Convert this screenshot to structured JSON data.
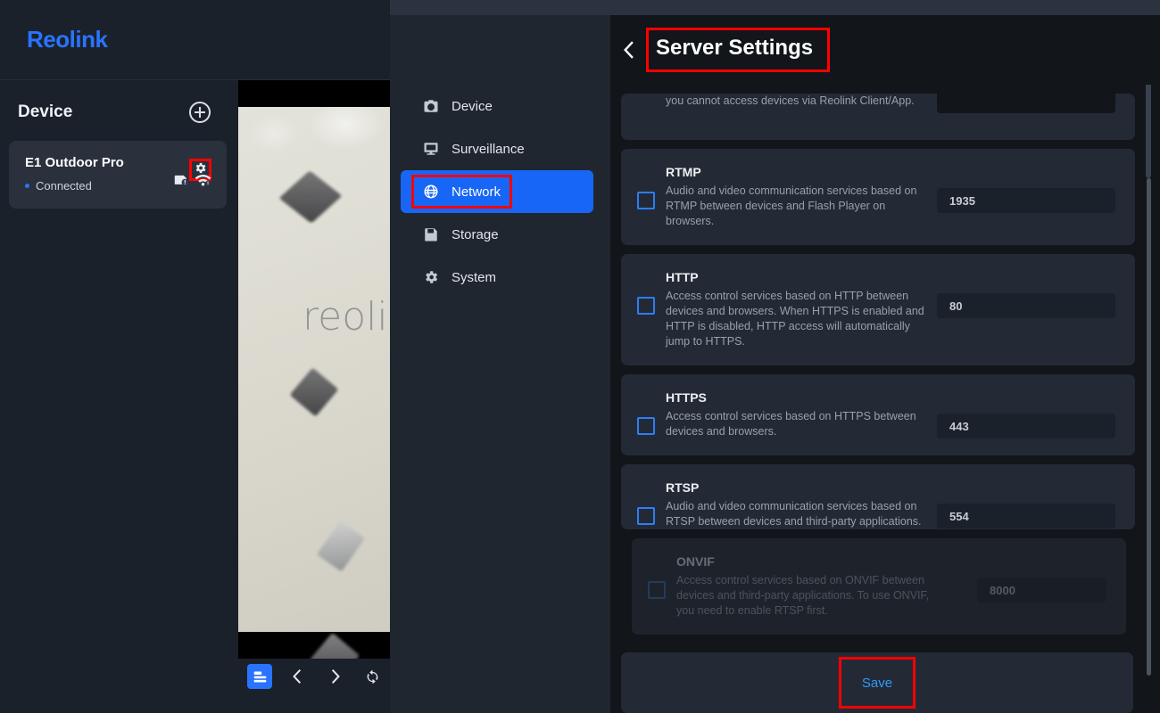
{
  "brand": {
    "name": "Reolink"
  },
  "left_panel": {
    "title": "Device",
    "add_button_label": "+",
    "device": {
      "name": "E1 Outdoor Pro",
      "status": "Connected"
    }
  },
  "video": {
    "watermark": "reolin"
  },
  "video_toolbar": {
    "buttons": [
      {
        "name": "layout-button",
        "label": "Layout"
      },
      {
        "name": "previous-button",
        "label": "Previous"
      },
      {
        "name": "next-button",
        "label": "Next"
      },
      {
        "name": "refresh-button",
        "label": "Refresh"
      }
    ]
  },
  "nav": {
    "items": [
      {
        "label": "Device",
        "icon": "camera-icon",
        "active": false
      },
      {
        "label": "Surveillance",
        "icon": "monitor-icon",
        "active": false
      },
      {
        "label": "Network",
        "icon": "globe-icon",
        "active": true
      },
      {
        "label": "Storage",
        "icon": "floppy-disk-icon",
        "active": false
      },
      {
        "label": "System",
        "icon": "gear-icon",
        "active": false
      }
    ]
  },
  "content": {
    "title": "Server Settings",
    "partial_card": {
      "desc": "you cannot access devices via Reolink Client/App."
    },
    "services": [
      {
        "name": "RTMP",
        "desc": "Audio and video communication services based on RTMP between devices and Flash Player on browsers.",
        "port": "1935",
        "checked": false,
        "disabled": false
      },
      {
        "name": "HTTP",
        "desc": "Access control services based on HTTP between devices and browsers. When HTTPS is enabled and HTTP is disabled, HTTP access will automatically jump to HTTPS.",
        "port": "80",
        "checked": false,
        "disabled": false
      },
      {
        "name": "HTTPS",
        "desc": "Access control services based on HTTPS between devices and browsers.",
        "port": "443",
        "checked": false,
        "disabled": false
      },
      {
        "name": "RTSP",
        "desc": "Audio and video communication services based on RTSP between devices and third-party applications.",
        "port": "554",
        "checked": false,
        "disabled": false
      },
      {
        "name": "ONVIF",
        "desc": "Access control services based on ONVIF between devices and third-party applications. To use ONVIF, you need to enable RTSP first.",
        "port": "8000",
        "checked": false,
        "disabled": true
      }
    ],
    "save_label": "Save"
  },
  "colors": {
    "accent_blue": "#2874ff",
    "nav_active": "#1866f5",
    "highlight_red": "#ff0000",
    "save_text": "#2c9bf7",
    "panel_bg": "#1b212b",
    "card_bg": "#242a35",
    "content_bg": "#121519"
  }
}
